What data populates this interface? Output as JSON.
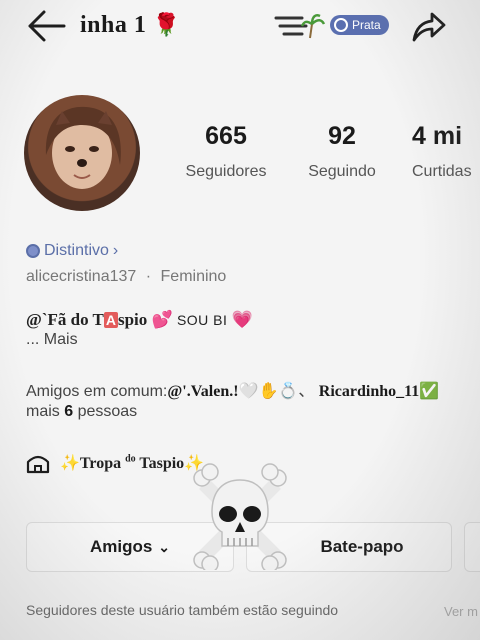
{
  "header": {
    "title": "inha 1",
    "title_emoji": "🌹",
    "menu_icon": "lines-palm-icon",
    "tier_badge": "Prata",
    "share_icon": "share-arrow-icon",
    "back_icon": "back-arrow-icon"
  },
  "profile": {
    "avatar_icon": "profile-photo",
    "stats": [
      {
        "value": "665",
        "label": "Seguidores"
      },
      {
        "value": "92",
        "label": "Seguindo"
      },
      {
        "value": "4 mi",
        "label": "Curtidas"
      }
    ],
    "badge_label": "Distintivo",
    "badge_chevron": "›",
    "username": "alicecristina137",
    "separator": "·",
    "gender": "Feminino"
  },
  "bio": {
    "prefix": "@`Fã do T",
    "highlight": "A",
    "suffix": "spio",
    "emoji1": "💕",
    "sou_bi": "SOU BI",
    "emoji2": "💗",
    "more": "...  Mais"
  },
  "mutual": {
    "prefix": "Amigos em comum:",
    "friend1": "@'.Valen.!",
    "friend1_emojis": "🤍✋💍、",
    "friend2": "Ricardinho_11",
    "friend2_emoji": "✅",
    "line2_prefix": "mais ",
    "line2_count": "6",
    "line2_suffix": " pessoas"
  },
  "group": {
    "icon": "house-tent-icon",
    "spark_left": "✨",
    "name_part1": "Tropa ",
    "name_sup": "do",
    "name_part2": " Taspio",
    "spark_right": "✨"
  },
  "actions": {
    "friends_label": "Amigos",
    "friends_chevron": "⌄",
    "chat_label": "Bate-papo"
  },
  "overlay": {
    "skull_icon": "skull-crossbones-icon"
  },
  "footer": {
    "text": "Seguidores deste usuário também estão seguindo",
    "more": "Ver m"
  }
}
